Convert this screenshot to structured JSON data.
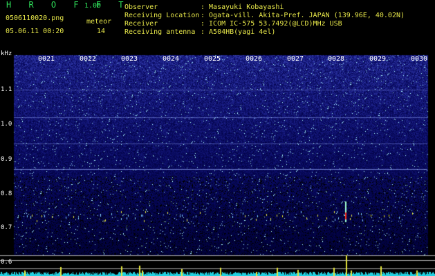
{
  "header": {
    "app_title": "H R O F F T",
    "version": "1.00",
    "filename": "0506110020.png",
    "meteor_label": "meteor",
    "datetime": "05.06.11 00:20",
    "meteor_count": "14"
  },
  "info": {
    "observer_label": "Observer",
    "observer_value": ": Masayuki Kobayashi",
    "location_label": "Receiving Location",
    "location_value": ": Ogata-vill. Akita-Pref. JAPAN (139.96E, 40.02N)",
    "receiver_label": "Receiver",
    "receiver_value": ": ICOM IC-575 53.7492(@LCD)MHz USB",
    "antenna_label": "Receiving antenna",
    "antenna_value": ": A504HB(yagi 4el)"
  },
  "spectrogram": {
    "unit_label": "kHz",
    "y_ticks": [
      "1.1",
      "1.0",
      "0.9",
      "0.8",
      "0.7",
      "0.6"
    ],
    "time_labels": [
      "0021",
      "0022",
      "0023",
      "0024",
      "0025",
      "0026",
      "0027",
      "0028",
      "0029",
      "0030"
    ],
    "colors": {
      "background": "#000000",
      "noise": "#1c2fb0",
      "signal": "#e6e63c",
      "meteor": "#ff3020",
      "baseline": "#22d0e0"
    }
  }
}
